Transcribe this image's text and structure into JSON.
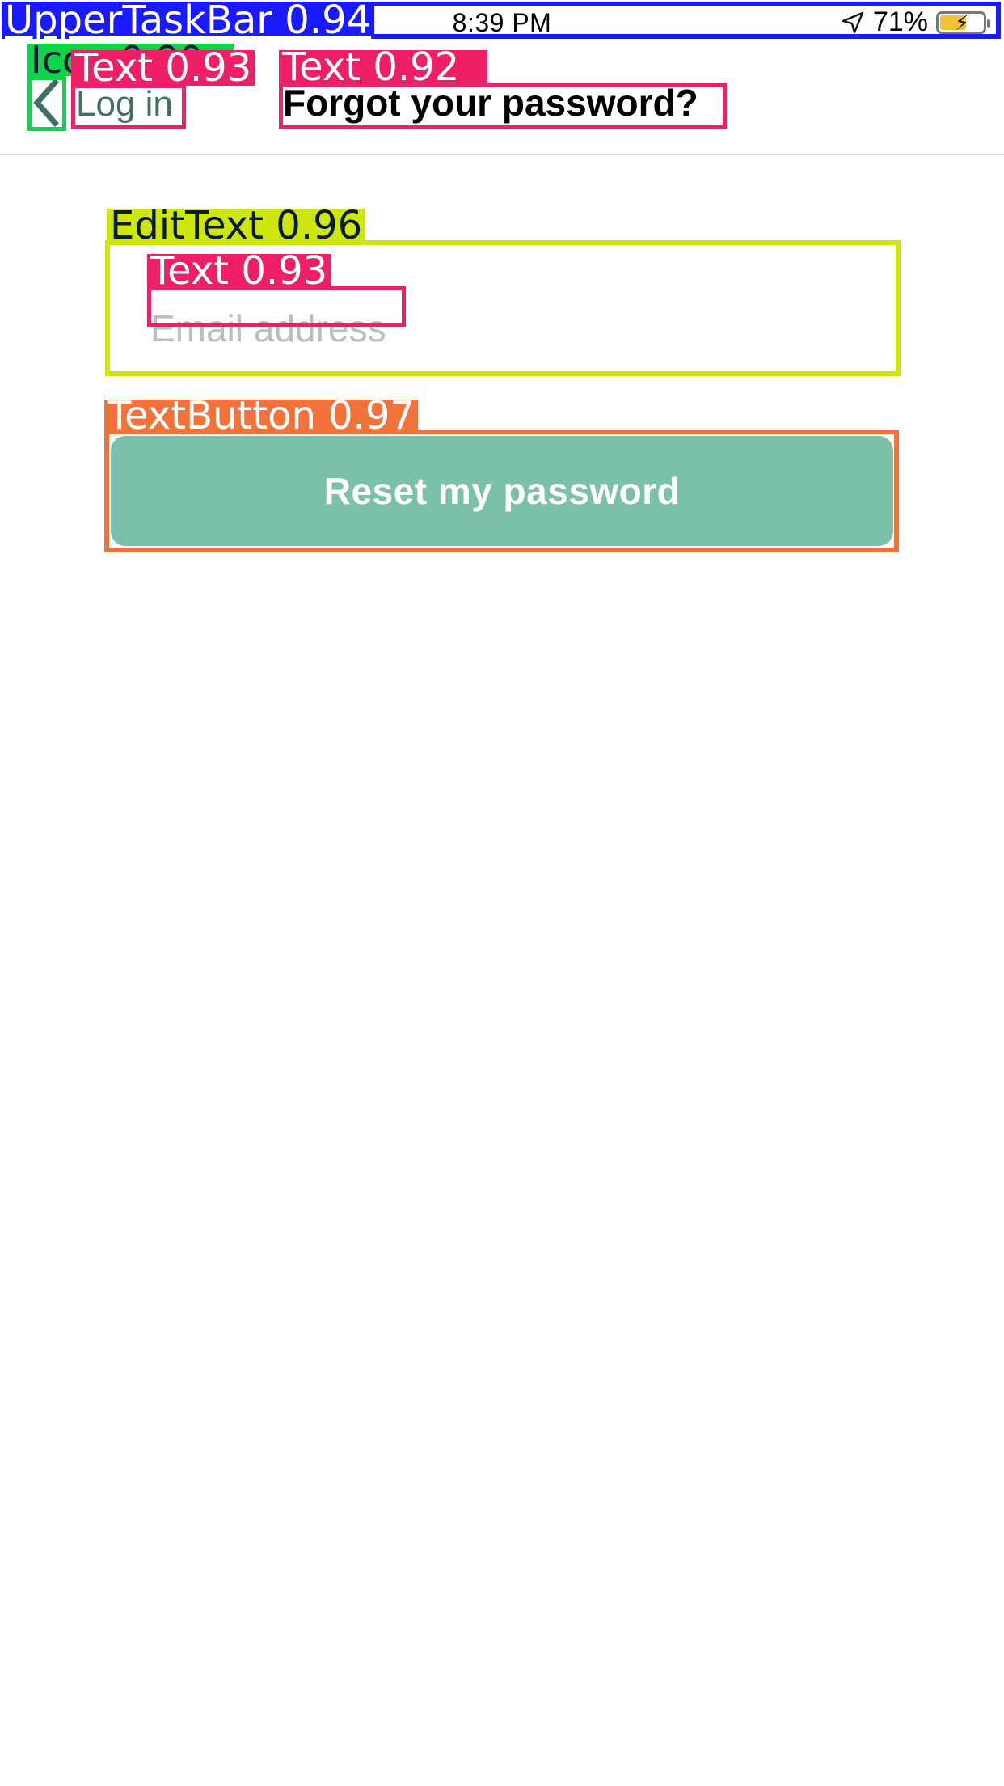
{
  "status_bar": {
    "time": "8:39 PM",
    "battery_percent": "71%",
    "battery_level": 0.71,
    "location_icon": "location-arrow-icon",
    "battery_icon": "battery-charging-icon"
  },
  "nav": {
    "back_icon": "chevron-left-icon",
    "back_label": "Log in",
    "title": "Forgot your password?"
  },
  "form": {
    "email_placeholder": "Email address",
    "email_value": ""
  },
  "actions": {
    "reset_label": "Reset my password"
  },
  "annotations": {
    "status_bar": "UpperTaskBar 0.94",
    "back_icon": "Icon 0.90",
    "back_label": "Text 0.93",
    "title": "Text 0.92",
    "edit_text": "EditText 0.96",
    "hint": "Text 0.93",
    "button": "TextButton 0.97"
  },
  "colors": {
    "accent": "#7bc1a8",
    "back_label": "#3f6f66",
    "placeholder": "#bdbdbd",
    "ann_taskbar": "#1a1aff",
    "ann_icon": "#12d44a",
    "ann_text": "#ee1f66",
    "ann_edittext": "#cde60d",
    "ann_button": "#f2723a"
  }
}
